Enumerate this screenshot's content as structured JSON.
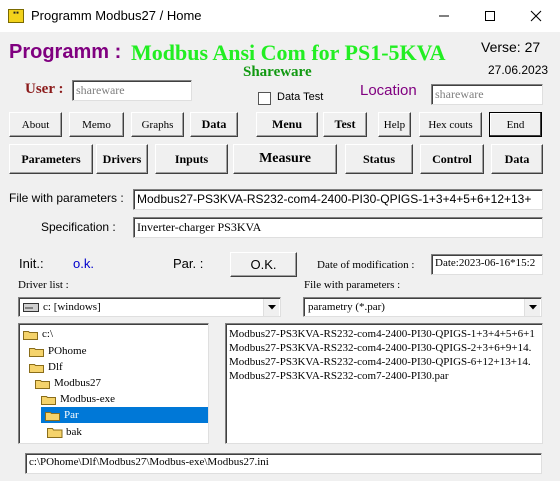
{
  "window": {
    "title": "Programm Modbus27 / Home",
    "icon": "app-icon",
    "controls": [
      "minimize-icon",
      "maximize-icon",
      "close-icon"
    ]
  },
  "header": {
    "programm_label": "Programm :",
    "program_title": "Modbus Ansi Com for PS1-5KVA",
    "verse": "Verse: 27",
    "date": "27.06.2023",
    "edition": "Shareware",
    "user_label": "User :",
    "user_value": "shareware",
    "location_label": "Location",
    "location_value": "shareware",
    "data_test_label": "Data Test",
    "data_test_checked": false
  },
  "toolbar_small": {
    "about": "About",
    "memo": "Memo",
    "graphs": "Graphs",
    "data": "Data",
    "menu": "Menu",
    "test": "Test",
    "help": "Help",
    "hex_couts": "Hex couts",
    "end": "End"
  },
  "toolbar_main": {
    "parameters": "Parameters",
    "drivers": "Drivers",
    "inputs": "Inputs",
    "measure": "Measure",
    "status": "Status",
    "control": "Control",
    "data": "Data"
  },
  "params": {
    "file_label": "File with parameters :",
    "file_value": "Modbus27-PS3KVA-RS232-com4-2400-PI30-QPIGS-1+3+4+5+6+12+13+",
    "spec_label": "Specification :",
    "spec_value": "Inverter-charger PS3KVA"
  },
  "status_row": {
    "init_label": "Init.:",
    "init_value": "o.k.",
    "par_label": "Par. :",
    "ok_button": "O.K.",
    "date_mod_label": "Date of  modification :",
    "date_mod_value": "Date:2023-06-16*15:2"
  },
  "drivers": {
    "label": "Driver list :",
    "selected": "c: [windows]",
    "icon": "drive-icon"
  },
  "file_filter": {
    "label": "File with parameters :",
    "selected": "parametry (*.par)"
  },
  "directories": [
    {
      "name": "c:\\",
      "state": "open"
    },
    {
      "name": "POhome",
      "state": "open"
    },
    {
      "name": "Dlf",
      "state": "open"
    },
    {
      "name": "Modbus27",
      "state": "open"
    },
    {
      "name": "Modbus-exe",
      "state": "open"
    },
    {
      "name": "Par",
      "state": "open",
      "selected": true
    },
    {
      "name": "bak",
      "state": "closed"
    }
  ],
  "files": [
    "Modbus27-PS3KVA-RS232-com4-2400-PI30-QPIGS-1+3+4+5+6+1",
    "Modbus27-PS3KVA-RS232-com4-2400-PI30-QPIGS-2+3+6+9+14.",
    "Modbus27-PS3KVA-RS232-com4-2400-PI30-QPIGS-6+12+13+14.",
    "Modbus27-PS3KVA-RS232-com7-2400-PI30.par"
  ],
  "path": "c:\\POhome\\Dlf\\Modbus27\\Modbus-exe\\Modbus27.ini",
  "colors": {
    "programm_label": "#800080",
    "program_title": "#22ee22",
    "edition": "#119911",
    "user_label": "#8b1a1a",
    "location_label": "#800080",
    "init_value": "#0000cc",
    "selection": "#0078d7",
    "folder": "#f5d36b"
  }
}
